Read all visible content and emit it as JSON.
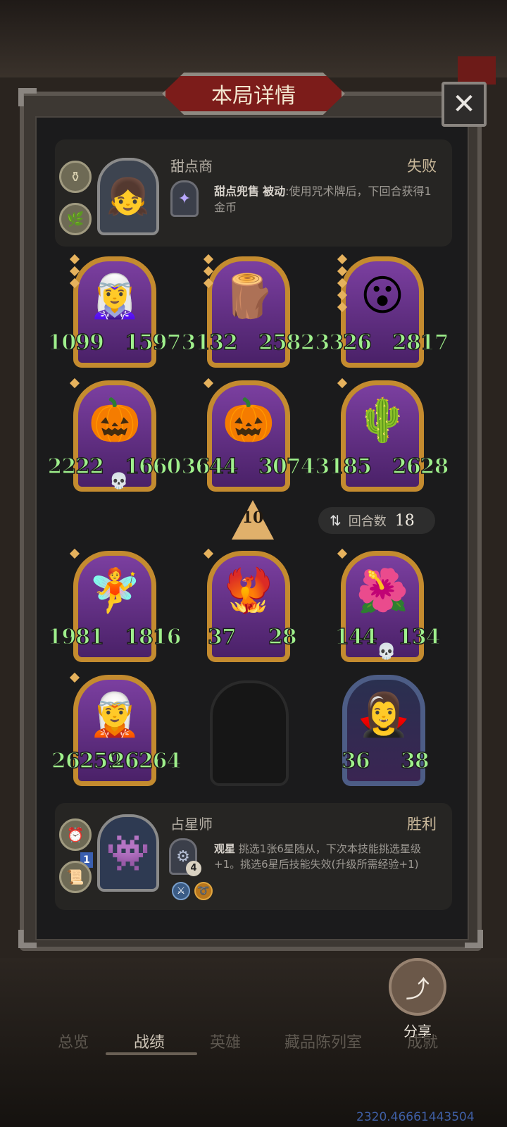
{
  "dialog": {
    "title": "本局详情",
    "close_icon": "close-icon"
  },
  "opponent": {
    "hero_name": "甜点商",
    "result": "失败",
    "skill_name": "甜点兜售",
    "skill_type": "被动",
    "skill_desc": ":使用咒术牌后，下回合获得1金币"
  },
  "minions_top": [
    {
      "attack": "1099",
      "health": "1597",
      "art": "🧝‍♀️",
      "stars": 3
    },
    {
      "attack": "3132",
      "health": "2582",
      "art": "🪵",
      "stars": 3
    },
    {
      "attack": "3326",
      "health": "2817",
      "art": "😮",
      "stars": 5
    },
    {
      "attack": "2222",
      "health": "1660",
      "art": "🎃",
      "stars": 1,
      "skull": true
    },
    {
      "attack": "3644",
      "health": "3074",
      "art": "🎃",
      "stars": 1
    },
    {
      "attack": "3185",
      "health": "2628",
      "art": "🌵",
      "stars": 1
    }
  ],
  "tier": "10",
  "rounds": {
    "label": "回合数",
    "value": "18"
  },
  "minions_bottom": [
    {
      "attack": "1981",
      "health": "1816",
      "art": "🧚",
      "stars": 1
    },
    {
      "attack": "37",
      "health": "28",
      "art": "🐦‍🔥",
      "stars": 1
    },
    {
      "attack": "144",
      "health": "134",
      "art": "🌺",
      "stars": 1,
      "skull": true
    },
    {
      "attack": "26259",
      "health": "26264",
      "art": "🧝",
      "stars": 1
    },
    {
      "attack": "36",
      "health": "38",
      "art": "🧛‍♀️",
      "stars": 0,
      "plain": true
    }
  ],
  "player": {
    "hero_name": "占星师",
    "result": "胜利",
    "skill_name": "观星",
    "skill_desc": " 挑选1张6星随从，下次本技能挑选星级+1。挑选6星后技能失效(升级所需经验+1)",
    "skill_level": "4",
    "item_level": "1"
  },
  "share_label": "分享",
  "nav": {
    "overview": "总览",
    "records": "战绩",
    "heroes": "英雄",
    "collection": "藏品陈列室",
    "achievements": "成就"
  },
  "coords_text": "2320.46661443504"
}
